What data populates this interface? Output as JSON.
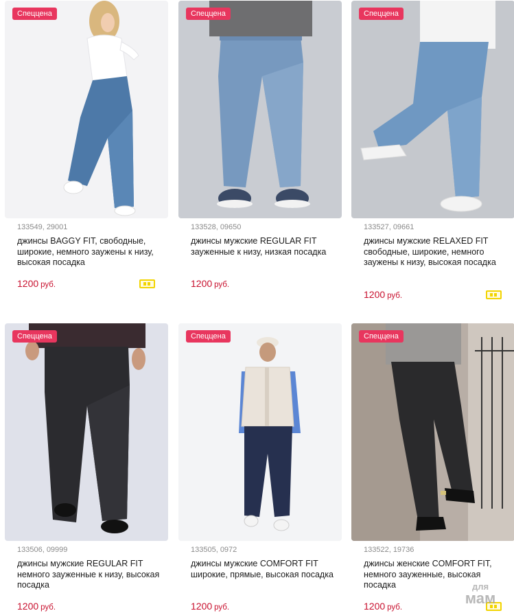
{
  "products": [
    {
      "badge": "Спеццена",
      "sku": "133549, 29001",
      "title": "джинсы BAGGY FIT, свободные, широкие, немного заужены к низу, высокая посадка",
      "price": "1200",
      "currency": "руб.",
      "image_icon": "woman-jeans-photo",
      "has_stock_icon": true
    },
    {
      "badge": "Спеццена",
      "sku": "133528, 09650",
      "title": "джинсы мужские REGULAR FIT зауженные к низу, низкая посадка",
      "price": "1200",
      "currency": "руб.",
      "image_icon": "man-jeans-photo",
      "has_stock_icon": false
    },
    {
      "badge": "Спеццена",
      "sku": "133527, 09661",
      "title": "джинсы мужские RELAXED FIT свободные, широкие, немного заужены к низу, высокая посадка",
      "price": "1200",
      "currency": "руб.",
      "image_icon": "man-jeans-photo",
      "has_stock_icon": true
    },
    {
      "badge": "Спеццена",
      "sku": "133506, 09999",
      "title": "джинсы мужские REGULAR FIT немного зауженные к низу, высокая посадка",
      "price": "1200",
      "currency": "руб.",
      "image_icon": "man-black-jeans-photo",
      "has_stock_icon": false
    },
    {
      "badge": "Спеццена",
      "sku": "133505, 0972",
      "title": "джинсы мужские COMFORT FIT широкие, прямые, высокая посадка",
      "price": "1200",
      "currency": "руб.",
      "image_icon": "man-vest-photo",
      "has_stock_icon": false
    },
    {
      "badge": "Спеццена",
      "sku": "133522, 19736",
      "title": "джинсы женские COMFORT FIT, немного зауженные, высокая посадка",
      "price": "1200",
      "currency": "руб.",
      "image_icon": "woman-black-jeans-photo",
      "has_stock_icon": true
    }
  ],
  "watermark": {
    "line1": "для",
    "line2": "мам"
  },
  "colors": {
    "badge": "#e8365e",
    "price": "#c8102e",
    "stock_icon": "#f2d400"
  }
}
